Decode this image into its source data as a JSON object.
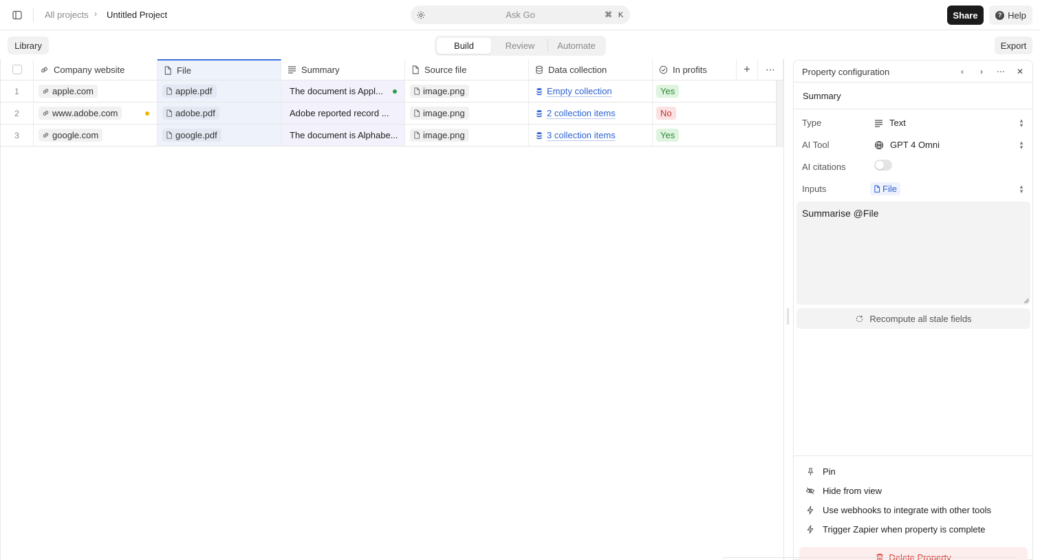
{
  "topbar": {
    "breadcrumb_all": "All projects",
    "breadcrumb_current": "Untitled Project",
    "ask_placeholder": "Ask Go",
    "shortcut_cmd": "⌘",
    "shortcut_key": "K",
    "share_label": "Share",
    "help_label": "Help"
  },
  "toolbar": {
    "library_label": "Library",
    "tabs": [
      {
        "label": "Build",
        "active": true
      },
      {
        "label": "Review",
        "active": false
      },
      {
        "label": "Automate",
        "active": false
      }
    ],
    "export_label": "Export"
  },
  "table": {
    "columns": [
      {
        "label": "Company website",
        "icon": "link-icon"
      },
      {
        "label": "File",
        "icon": "file-icon"
      },
      {
        "label": "Summary",
        "icon": "text-lines-icon"
      },
      {
        "label": "Source file",
        "icon": "file-icon"
      },
      {
        "label": "Data collection",
        "icon": "database-icon"
      },
      {
        "label": "In profits",
        "icon": "check-circle-icon"
      }
    ],
    "rows": [
      {
        "num": "1",
        "website": "apple.com",
        "file": "apple.pdf",
        "summary": "The document is Appl...",
        "source": "image.png",
        "collection": "Empty collection",
        "profits": "Yes"
      },
      {
        "num": "2",
        "website": "www.adobe.com",
        "file": "adobe.pdf",
        "summary": "Adobe reported record ...",
        "source": "image.png",
        "collection": "2 collection items",
        "profits": "No"
      },
      {
        "num": "3",
        "website": "google.com",
        "file": "google.pdf",
        "summary": "The document is Alphabe...",
        "source": "image.png",
        "collection": "3 collection items",
        "profits": "Yes"
      }
    ]
  },
  "panel": {
    "title": "Property configuration",
    "property_name": "Summary",
    "type_label": "Type",
    "type_value": "Text",
    "tool_label": "AI Tool",
    "tool_value": "GPT 4 Omni",
    "citations_label": "AI citations",
    "citations_enabled": false,
    "inputs_label": "Inputs",
    "inputs_value": "File",
    "prompt": "Summarise @File",
    "recompute_label": "Recompute all stale fields",
    "actions": [
      {
        "label": "Pin",
        "icon": "pin-icon"
      },
      {
        "label": "Hide from view",
        "icon": "eye-off-icon"
      },
      {
        "label": "Use webhooks to integrate with other tools",
        "icon": "bolt-icon"
      },
      {
        "label": "Trigger Zapier when property is complete",
        "icon": "bolt-icon"
      }
    ],
    "delete_label": "Delete Property"
  },
  "colors": {
    "accent_blue": "#2d62d2",
    "yes_green": "#2f8a3c",
    "no_red": "#c4312b",
    "status_green_dot": "#2f9a49",
    "status_amber_dot": "#f0b400"
  }
}
